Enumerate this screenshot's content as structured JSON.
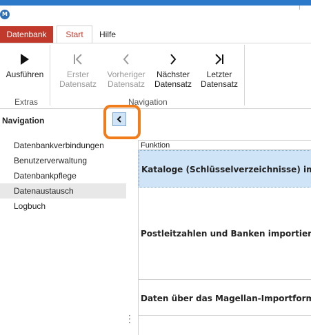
{
  "app": {
    "icon_letter": "M"
  },
  "ribbon_tabs": {
    "file": "Datenbank",
    "start": "Start",
    "help": "Hilfe"
  },
  "ribbon": {
    "run": "Ausführen",
    "first": [
      "Erster",
      "Datensatz"
    ],
    "previous": [
      "Vorheriger",
      "Datensatz"
    ],
    "next": [
      "Nächster",
      "Datensatz"
    ],
    "last": [
      "Letzter",
      "Datensatz"
    ],
    "group_extras": "Extras",
    "group_navigation": "Navigation"
  },
  "navigation": {
    "title": "Navigation",
    "items": [
      {
        "label": "Datenbankverbindungen",
        "selected": false
      },
      {
        "label": "Benutzerverwaltung",
        "selected": false
      },
      {
        "label": "Datenbankpflege",
        "selected": false
      },
      {
        "label": "Datenaustausch",
        "selected": true
      },
      {
        "label": "Logbuch",
        "selected": false
      }
    ]
  },
  "table": {
    "header": "Funktion",
    "rows": [
      "Kataloge (Schlüsselverzeichnisse) importieren",
      "Postleitzahlen und Banken importieren",
      "Daten über das Magellan-Importformat importieren"
    ]
  },
  "colors": {
    "accent_red": "#c0392b",
    "selection_blue": "#cfe4f7",
    "highlight_orange": "#f07c1c"
  }
}
